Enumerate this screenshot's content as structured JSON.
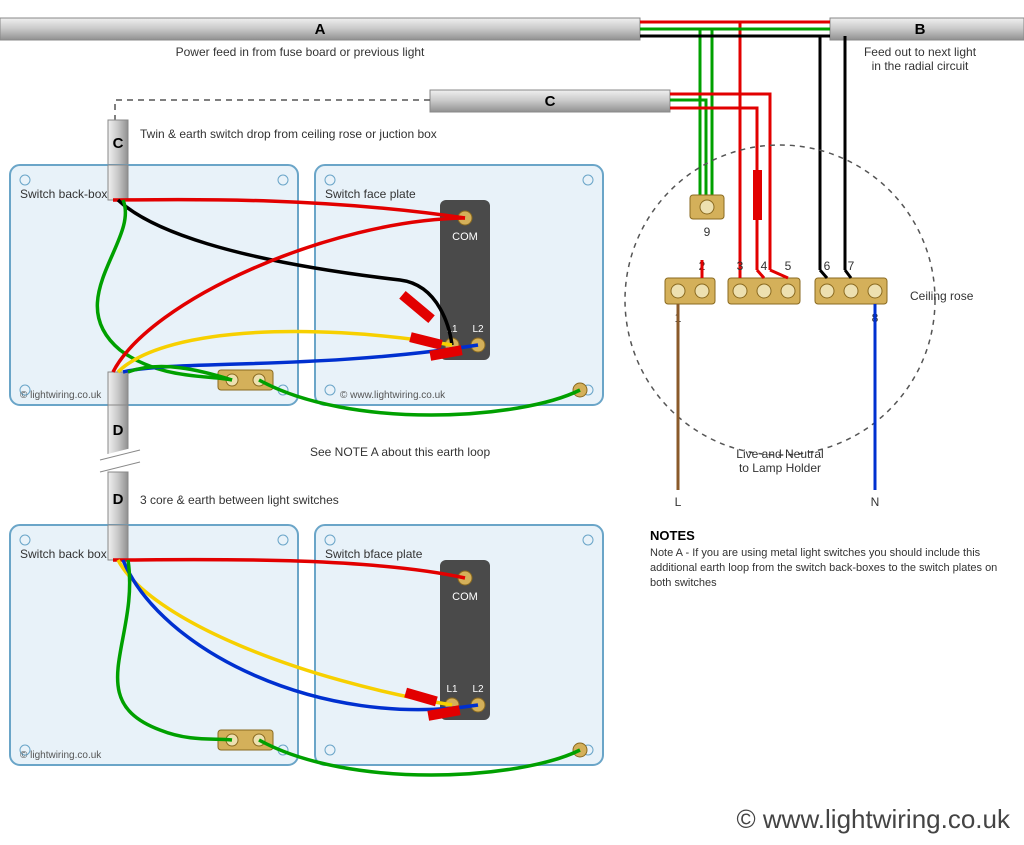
{
  "cables": {
    "A": {
      "letter": "A",
      "caption": "Power feed in from fuse board or previous light"
    },
    "B": {
      "letter": "B",
      "caption_line1": "Feed out to next light",
      "caption_line2": "in the radial circuit"
    },
    "C_top": {
      "letter": "C"
    },
    "C_switch": {
      "letter": "C",
      "caption": "Twin & earth switch drop from ceiling rose or juction box"
    },
    "D": {
      "letter": "D",
      "caption": "3 core & earth between light switches"
    }
  },
  "boxes": {
    "backbox1": "Switch back-box",
    "faceplate1": "Switch face plate",
    "backbox2": "Switch back box",
    "faceplate2": "Switch bface plate"
  },
  "switch_terminals": {
    "com": "COM",
    "l1": "L1",
    "l2": "L2"
  },
  "ceiling_rose": {
    "label": "Ceiling rose",
    "terminals": [
      "1",
      "2",
      "3",
      "4",
      "5",
      "6",
      "7",
      "8",
      "9"
    ],
    "lamp_caption": "Live and Neutral\nto Lamp Holder",
    "L": "L",
    "N": "N"
  },
  "earth_note": "See NOTE A about this earth loop",
  "notes": {
    "title": "NOTES",
    "body": "Note A - If you are using metal light switches you should include this additional earth loop from the switch back-boxes to the switch plates on both switches"
  },
  "copyright": {
    "small": "© lightwiring.co.uk",
    "small2": "© www.lightwiring.co.uk",
    "large": "© www.lightwiring.co.uk"
  },
  "colors": {
    "red": "#e20000",
    "green": "#00a000",
    "black": "#000000",
    "blue": "#0030d0",
    "yellow": "#f7d000",
    "brown": "#8a5a2a",
    "grey": "#c8c8c8",
    "darkgrey": "#888",
    "boxfill": "#e8f2f9",
    "boxstroke": "#6aa5c8",
    "switchbody": "#4a4a4a"
  }
}
